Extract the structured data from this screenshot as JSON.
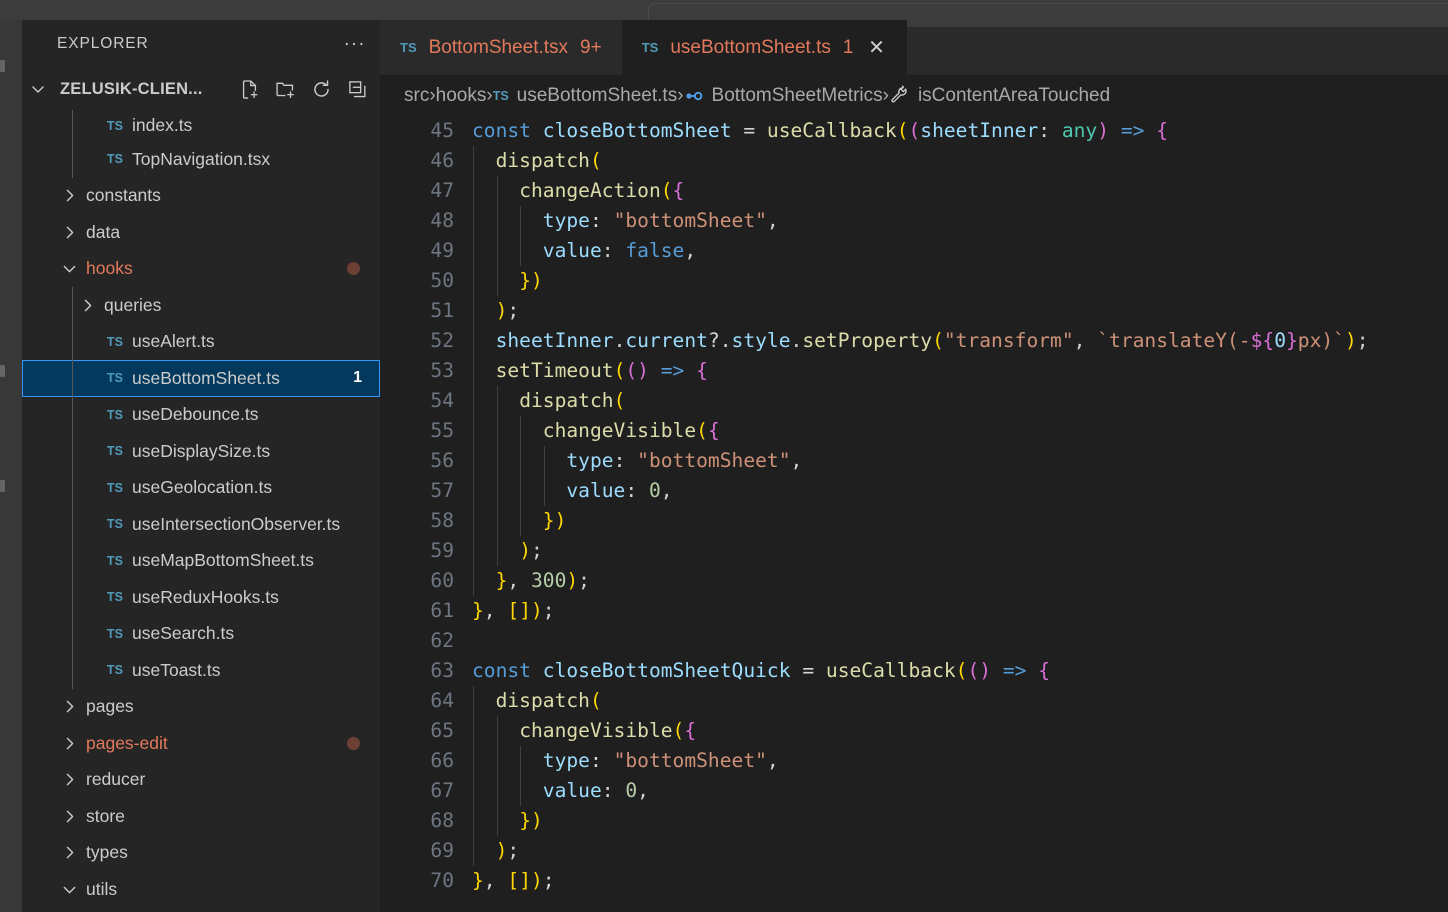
{
  "window": {
    "title_bar_visible": true
  },
  "activity_bar": {
    "items": [
      "explorer",
      "search",
      "scm"
    ]
  },
  "sidebar": {
    "title": "EXPLORER",
    "overflow_label": "...",
    "folder": {
      "name": "ZELUSIK-CLIEN...",
      "expanded": true,
      "actions": [
        {
          "name": "new-file-icon",
          "tooltip": "New File"
        },
        {
          "name": "new-folder-icon",
          "tooltip": "New Folder"
        },
        {
          "name": "refresh-icon",
          "tooltip": "Refresh Explorer"
        },
        {
          "name": "collapse-all-icon",
          "tooltip": "Collapse Folders in Explorer"
        }
      ]
    },
    "tree": [
      {
        "label": "index.ts",
        "kind": "file",
        "depth": 3,
        "icon": "TS",
        "partial": true
      },
      {
        "label": "TopNavigation.tsx",
        "kind": "file",
        "depth": 3,
        "icon": "TS"
      },
      {
        "label": "constants",
        "kind": "folder",
        "depth": 2,
        "expanded": false
      },
      {
        "label": "data",
        "kind": "folder",
        "depth": 2,
        "expanded": false
      },
      {
        "label": "hooks",
        "kind": "folder",
        "depth": 2,
        "expanded": true,
        "dirty": true,
        "dot": true
      },
      {
        "label": "queries",
        "kind": "folder",
        "depth": 3,
        "expanded": false
      },
      {
        "label": "useAlert.ts",
        "kind": "file",
        "depth": 3,
        "icon": "TS"
      },
      {
        "label": "useBottomSheet.ts",
        "kind": "file",
        "depth": 3,
        "icon": "TS",
        "selected": true,
        "badge": "1"
      },
      {
        "label": "useDebounce.ts",
        "kind": "file",
        "depth": 3,
        "icon": "TS"
      },
      {
        "label": "useDisplaySize.ts",
        "kind": "file",
        "depth": 3,
        "icon": "TS"
      },
      {
        "label": "useGeolocation.ts",
        "kind": "file",
        "depth": 3,
        "icon": "TS"
      },
      {
        "label": "useIntersectionObserver.ts",
        "kind": "file",
        "depth": 3,
        "icon": "TS"
      },
      {
        "label": "useMapBottomSheet.ts",
        "kind": "file",
        "depth": 3,
        "icon": "TS"
      },
      {
        "label": "useReduxHooks.ts",
        "kind": "file",
        "depth": 3,
        "icon": "TS"
      },
      {
        "label": "useSearch.ts",
        "kind": "file",
        "depth": 3,
        "icon": "TS"
      },
      {
        "label": "useToast.ts",
        "kind": "file",
        "depth": 3,
        "icon": "TS"
      },
      {
        "label": "pages",
        "kind": "folder",
        "depth": 2,
        "expanded": false
      },
      {
        "label": "pages-edit",
        "kind": "folder",
        "depth": 2,
        "expanded": false,
        "dirty": true,
        "dot": true
      },
      {
        "label": "reducer",
        "kind": "folder",
        "depth": 2,
        "expanded": false
      },
      {
        "label": "store",
        "kind": "folder",
        "depth": 2,
        "expanded": false
      },
      {
        "label": "types",
        "kind": "folder",
        "depth": 2,
        "expanded": false
      },
      {
        "label": "utils",
        "kind": "folder",
        "depth": 2,
        "expanded": true
      }
    ]
  },
  "tabs": [
    {
      "icon": "TS",
      "label": "BottomSheet.tsx",
      "count": "9+",
      "active": false,
      "closable": false
    },
    {
      "icon": "TS",
      "label": "useBottomSheet.ts",
      "count": "1",
      "active": true,
      "closable": true,
      "close_glyph": "✕"
    }
  ],
  "breadcrumbs": [
    {
      "label": "src",
      "icon": null
    },
    {
      "label": "hooks",
      "icon": null
    },
    {
      "label": "useBottomSheet.ts",
      "icon": "TS"
    },
    {
      "label": "BottomSheetMetrics",
      "icon": "interface-icon"
    },
    {
      "label": "isContentAreaTouched",
      "icon": "method-icon"
    }
  ],
  "editor": {
    "first_visible_line": 45,
    "line_numbers": [
      45,
      46,
      47,
      48,
      49,
      50,
      51,
      52,
      53,
      54,
      55,
      56,
      57,
      58,
      59,
      60,
      61,
      62,
      63,
      64,
      65,
      66,
      67,
      68,
      69,
      70
    ],
    "lines": [
      "const closeBottomSheet = useCallback((sheetInner: any) => {",
      "  dispatch(",
      "    changeAction({",
      "      type: \"bottomSheet\",",
      "      value: false,",
      "    })",
      "  );",
      "  sheetInner.current?.style.setProperty(\"transform\", `translateY(-${0}px)`);",
      "  setTimeout(() => {",
      "    dispatch(",
      "      changeVisible({",
      "        type: \"bottomSheet\",",
      "        value: 0,",
      "      })",
      "    );",
      "  }, 300);",
      "}, []);",
      "",
      "const closeBottomSheetQuick = useCallback(() => {",
      "  dispatch(",
      "    changeVisible({",
      "      type: \"bottomSheet\",",
      "      value: 0,",
      "    })",
      "  );",
      "}, []);"
    ]
  },
  "colors": {
    "editor_bg": "#1f1f1f",
    "sidebar_bg": "#252526",
    "tabbar_bg": "#2a2a2a",
    "activitybar_bg": "#383838",
    "titlebar_bg": "#3c3c3c",
    "selection_bg": "#04395e",
    "selection_border": "#3794ff",
    "dirty_fg": "#e2795b",
    "ts_icon": "#519aba",
    "dot": "#6d4036",
    "linenumber_fg": "#6e7681"
  }
}
